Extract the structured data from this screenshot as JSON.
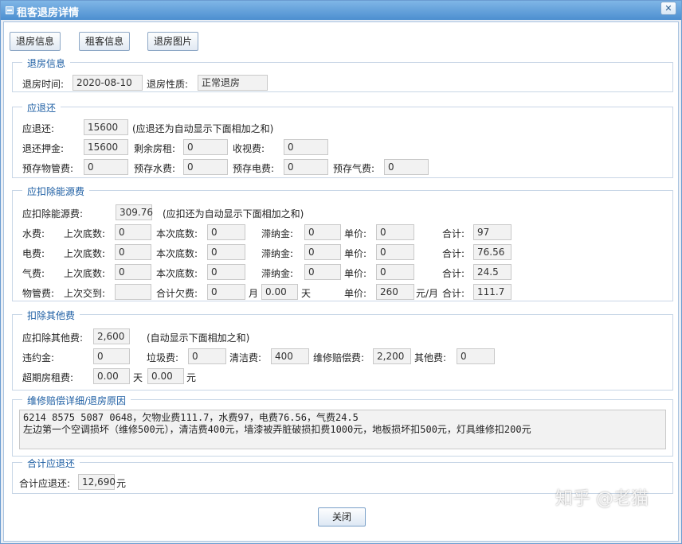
{
  "window": {
    "title": "租客退房详情",
    "close_glyph": "✕"
  },
  "top_buttons": [
    "退房信息",
    "租客信息",
    "退房图片"
  ],
  "checkout_info": {
    "legend": "退房信息",
    "time_label": "退房时间:",
    "time_value": "2020-08-10",
    "type_label": "退房性质:",
    "type_value": "正常退房"
  },
  "refund": {
    "legend": "应退还",
    "total_label": "应退还:",
    "total_value": "15600",
    "total_note": "(应退还为自动显示下面相加之和)",
    "deposit_label": "退还押金:",
    "deposit_value": "15600",
    "rent_left_label": "剩余房租:",
    "rent_left_value": "0",
    "tv_label": "收视费:",
    "tv_value": "0",
    "prop_label": "预存物管费:",
    "prop_value": "0",
    "water_label": "预存水费:",
    "water_value": "0",
    "elec_label": "预存电费:",
    "elec_value": "0",
    "gas_label": "预存气费:",
    "gas_value": "0"
  },
  "energy": {
    "legend": "应扣除能源费",
    "total_label": "应扣除能源费:",
    "total_value": "309.76",
    "total_note": "(应扣还为自动显示下面相加之和)",
    "last_label": "上次底数:",
    "cur_label": "本次底数:",
    "late_label": "滞纳金:",
    "price_label": "单价:",
    "sum_label": "合计:",
    "rows": [
      {
        "name": "水费:",
        "last": "0",
        "cur": "0",
        "late": "0",
        "price": "0",
        "sum": "97"
      },
      {
        "name": "电费:",
        "last": "0",
        "cur": "0",
        "late": "0",
        "price": "0",
        "sum": "76.56"
      },
      {
        "name": "气费:",
        "last": "0",
        "cur": "0",
        "late": "0",
        "price": "0",
        "sum": "24.5"
      }
    ],
    "prop": {
      "name": "物管费:",
      "last_pay_label": "上次交到:",
      "last_pay_value": "",
      "owe_label": "合计欠费:",
      "months": "0",
      "month_unit": "月",
      "days": "0.00",
      "day_unit": "天",
      "price_label": "单价:",
      "price": "260",
      "price_unit": "元/月",
      "sum_label": "合计:",
      "sum": "111.7"
    }
  },
  "other": {
    "legend": "扣除其他费",
    "total_label": "应扣除其他费:",
    "total_value": "2,600",
    "total_note": "(自动显示下面相加之和)",
    "breach_label": "违约金:",
    "breach_value": "0",
    "garbage_label": "垃圾费:",
    "garbage_value": "0",
    "clean_label": "清洁费:",
    "clean_value": "400",
    "repair_label": "维修赔偿费:",
    "repair_value": "2,200",
    "misc_label": "其他费:",
    "misc_value": "0",
    "overdue_label": "超期房租费:",
    "overdue_days": "0.00",
    "day_unit": "天",
    "overdue_amount": "0.00",
    "yuan_unit": "元"
  },
  "repair_detail": {
    "legend": "维修赔偿详细/退房原因",
    "line1": "6214 8575 5087 0648，欠物业费111.7，水费97，电费76.56，气费24.5",
    "line2": "左边第一个空调损坏（维修500元），清洁费400元，墙漆被弄脏破损扣费1000元，地板损坏扣500元，灯具维修扣200元"
  },
  "total_refund": {
    "legend": "合计应退还",
    "label": "合计应退还:",
    "value": "12,690",
    "unit": "元"
  },
  "close_button": "关闭",
  "watermark": "知乎 @老猫"
}
